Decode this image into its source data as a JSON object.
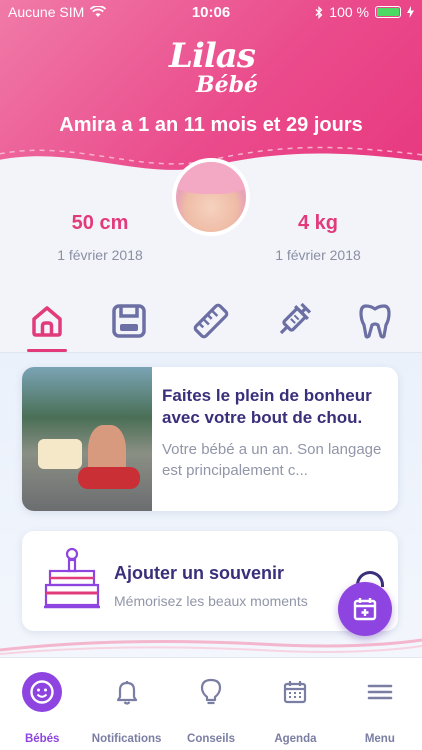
{
  "status_bar": {
    "carrier": "Aucune SIM",
    "time": "10:06",
    "battery": "100 %"
  },
  "logo": {
    "line1": "Lilas",
    "line2": "Bébé"
  },
  "baby": {
    "age_text": "Amira a 1 an 11 mois et 29 jours"
  },
  "measures": {
    "height": {
      "value": "50 cm",
      "date": "1 février 2018"
    },
    "weight": {
      "value": "4 kg",
      "date": "1 février 2018"
    }
  },
  "category_tabs": [
    {
      "icon": "home-icon",
      "active": true
    },
    {
      "icon": "scale-icon",
      "active": false
    },
    {
      "icon": "ruler-icon",
      "active": false
    },
    {
      "icon": "syringe-icon",
      "active": false
    },
    {
      "icon": "tooth-icon",
      "active": false
    }
  ],
  "article_card": {
    "title": "Faites le plein de bonheur avec votre bout de chou.",
    "description": "Votre bébé a un an. Son langage est principalement c..."
  },
  "memory_card": {
    "title": "Ajouter un souvenir",
    "subtitle": "Mémorisez les beaux moments"
  },
  "tabbar": {
    "items": [
      {
        "label": "Bébés",
        "icon": "baby-face-icon",
        "active": true
      },
      {
        "label": "Notifications",
        "icon": "bell-icon",
        "active": false
      },
      {
        "label": "Conseils",
        "icon": "lightbulb-icon",
        "active": false
      },
      {
        "label": "Agenda",
        "icon": "calendar-icon",
        "active": false
      },
      {
        "label": "Menu",
        "icon": "menu-icon",
        "active": false
      }
    ]
  },
  "colors": {
    "pink": "#e23b7c",
    "purple": "#8e44e0",
    "navy": "#3a2f7a",
    "tab_icon": "#6b6fa3"
  }
}
